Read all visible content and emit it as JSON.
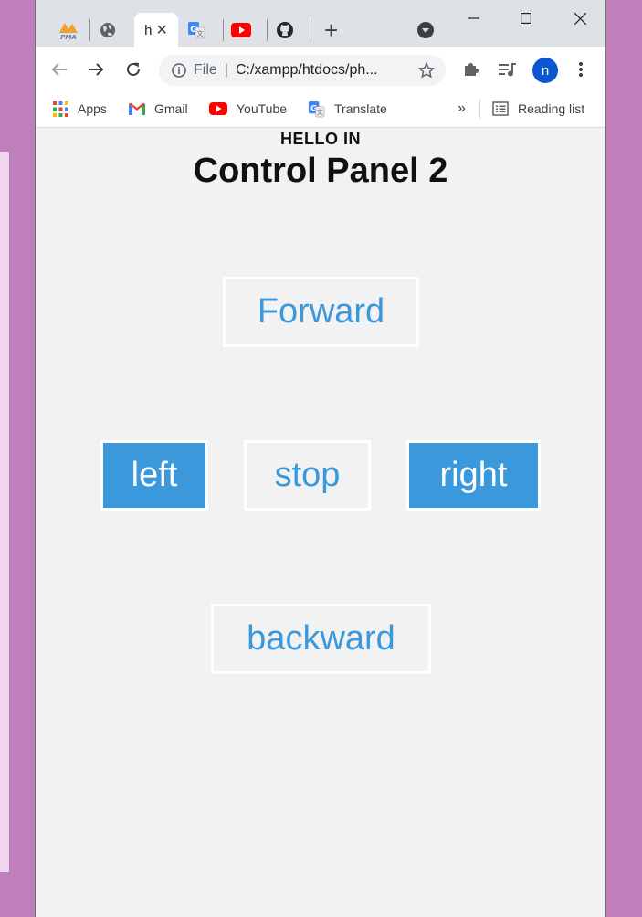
{
  "browser": {
    "active_tab_title": "h",
    "address": {
      "scheme_label": "File",
      "url": "C:/xampp/htdocs/ph..."
    },
    "avatar_initial": "n",
    "bookmarks": [
      {
        "label": "Apps",
        "icon": "apps-grid-icon"
      },
      {
        "label": "Gmail",
        "icon": "gmail-icon"
      },
      {
        "label": "YouTube",
        "icon": "youtube-icon"
      },
      {
        "label": "Translate",
        "icon": "translate-icon"
      }
    ],
    "overflow_label": "»",
    "reading_list_label": "Reading list"
  },
  "page": {
    "greeting": "HELLO IN",
    "title": "Control Panel 2",
    "buttons": {
      "forward": "Forward",
      "left": "left",
      "stop": "stop",
      "right": "right",
      "backward": "backward"
    }
  },
  "colors": {
    "accent": "#3a98db",
    "page_background": "#f2f2f2",
    "desktop": "#bf7fbb"
  }
}
